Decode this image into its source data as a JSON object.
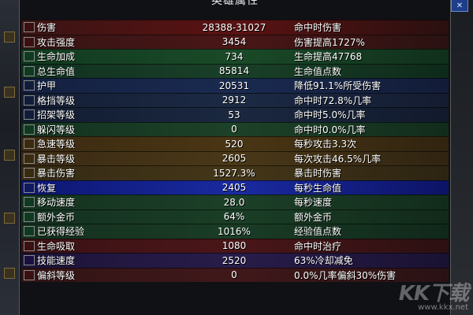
{
  "panel": {
    "title": "英雄属性"
  },
  "close_icon": "close-icon",
  "rows": [
    {
      "label": "伤害",
      "value": "28388-31027",
      "desc": "命中时伤害",
      "swatch": "#3a1010",
      "bg": "linear-gradient(90deg,#3a1414,#5a1212 50%,#2a1010)"
    },
    {
      "label": "攻击强度",
      "value": "3454",
      "desc": "伤害提高1727%",
      "swatch": "#3a1010",
      "bg": "linear-gradient(90deg,#351414,#4a1616 50%,#2a1212)"
    },
    {
      "label": "生命加成",
      "value": "734",
      "desc": "生命提高47768",
      "swatch": "#103a20",
      "bg": "linear-gradient(90deg,#123a20,#1a4a28 50%,#10301c)"
    },
    {
      "label": "总生命值",
      "value": "85814",
      "desc": "生命值点数",
      "swatch": "#103a20",
      "bg": "linear-gradient(90deg,#103020,#1a4028 50%,#0e2a1a)"
    },
    {
      "label": "护甲",
      "value": "20531",
      "desc": "降低91.1%所受伤害",
      "swatch": "#101c3a",
      "bg": "linear-gradient(90deg,#142040,#1a2a50 50%,#121c38)"
    },
    {
      "label": "格挡等级",
      "value": "2912",
      "desc": "命中时72.8%几率",
      "swatch": "#101c3a",
      "bg": "linear-gradient(90deg,#141e34,#1c2a44 50%,#141c30)"
    },
    {
      "label": "招架等级",
      "value": "53",
      "desc": "命中时5.0%几率",
      "swatch": "#101c3a",
      "bg": "linear-gradient(90deg,#121c30,#1a2840 50%,#121a2c)"
    },
    {
      "label": "躲闪等级",
      "value": "0",
      "desc": "命中时0.0%几率",
      "swatch": "#103a20",
      "bg": "linear-gradient(90deg,#143220,#1c4228 50%,#122c1c)"
    },
    {
      "label": "急速等级",
      "value": "520",
      "desc": "每秒攻击3.3次",
      "swatch": "#3a2a10",
      "bg": "linear-gradient(90deg,#3a2a12,#4a3614 50%,#302410)"
    },
    {
      "label": "暴击等级",
      "value": "2605",
      "desc": "每次攻击46.5%几率",
      "swatch": "#3a2a10",
      "bg": "linear-gradient(90deg,#3a2a14,#4a3818 50%,#302412)"
    },
    {
      "label": "暴击伤害",
      "value": "1527.3%",
      "desc": "暴击时伤害",
      "swatch": "#3a2a10",
      "bg": "linear-gradient(90deg,#342a14,#443618 50%,#2c2412)"
    },
    {
      "label": "恢复",
      "value": "2405",
      "desc": "每秒生命值",
      "swatch": "#101a60",
      "bg": "linear-gradient(90deg,#0c1670,#1a2aa0 50%,#0c1466)"
    },
    {
      "label": "移动速度",
      "value": "28.0",
      "desc": "每秒速度",
      "swatch": "#103a20",
      "bg": "linear-gradient(90deg,#143220,#1c4028 50%,#122c1c)"
    },
    {
      "label": "额外金币",
      "value": "64%",
      "desc": "额外金币",
      "swatch": "#103a20",
      "bg": "linear-gradient(90deg,#143020,#1a3e26 50%,#122a1a)"
    },
    {
      "label": "已获得经验",
      "value": "1016%",
      "desc": "经验值点数",
      "swatch": "#103a20",
      "bg": "linear-gradient(90deg,#14301e,#1a3c26 50%,#10281a)"
    },
    {
      "label": "生命吸取",
      "value": "1080",
      "desc": "命中时治疗",
      "swatch": "#3a1010",
      "bg": "linear-gradient(90deg,#3a1214,#4a1618 50%,#2c1012)"
    },
    {
      "label": "技能速度",
      "value": "2520",
      "desc": "63%冷却减免",
      "swatch": "#1a1040",
      "bg": "linear-gradient(90deg,#1c1438,#281c4a 50%,#1a1232)"
    },
    {
      "label": "偏斜等级",
      "value": "0",
      "desc": "0.0%几率偏斜30%伤害",
      "swatch": "#3a1010",
      "bg": "linear-gradient(90deg,#321416,#40181a 50%,#2a1214)"
    }
  ],
  "watermark": {
    "mark": "KK下载",
    "url": "www.kkx.net"
  }
}
